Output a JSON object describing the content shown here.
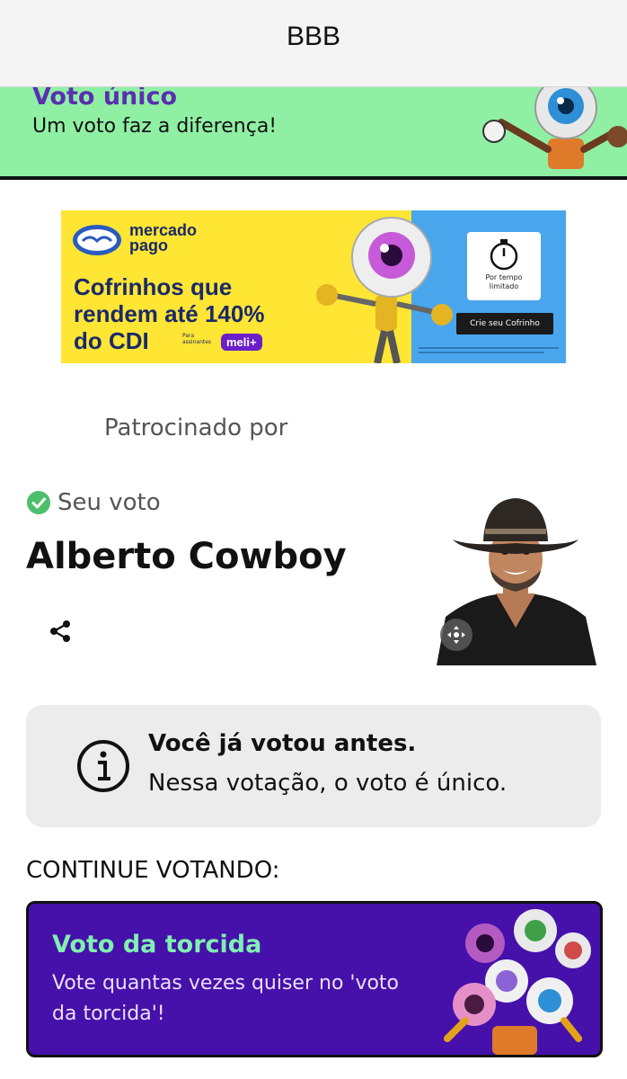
{
  "header": {
    "title": "BBB"
  },
  "banner": {
    "title": "Voto único",
    "subtitle": "Um voto faz a diferença!"
  },
  "ad": {
    "brand_line1": "mercado",
    "brand_line2": "pago",
    "headline_line1": "Cofrinhos que",
    "headline_line2": "rendem até 140%",
    "headline_line3": "do CDI",
    "fine_print": "Para assinantes",
    "badge": "meli+",
    "timer_text_line1": "Por tempo",
    "timer_text_line2": "limitado",
    "cta": "Crie seu Cofrinho"
  },
  "sponsored_label": "Patrocinado por",
  "vote": {
    "status_label": "Seu voto",
    "candidate_name": "Alberto Cowboy"
  },
  "info": {
    "title": "Você já votou antes.",
    "text": "Nessa votação, o voto é único."
  },
  "continue_label": "CONTINUE VOTANDO:",
  "torcida_card": {
    "title": "Voto da torcida",
    "text": "Vote quantas vezes quiser no 'voto da torcida'!"
  },
  "colors": {
    "banner_bg": "#8ff0a4",
    "banner_title": "#5a2fb0",
    "torcida_bg": "#4511aa",
    "torcida_title": "#7ff0b0",
    "check_green": "#4cbf6b",
    "ad_yellow": "#ffe534",
    "ad_blue": "#4aa6ec"
  }
}
